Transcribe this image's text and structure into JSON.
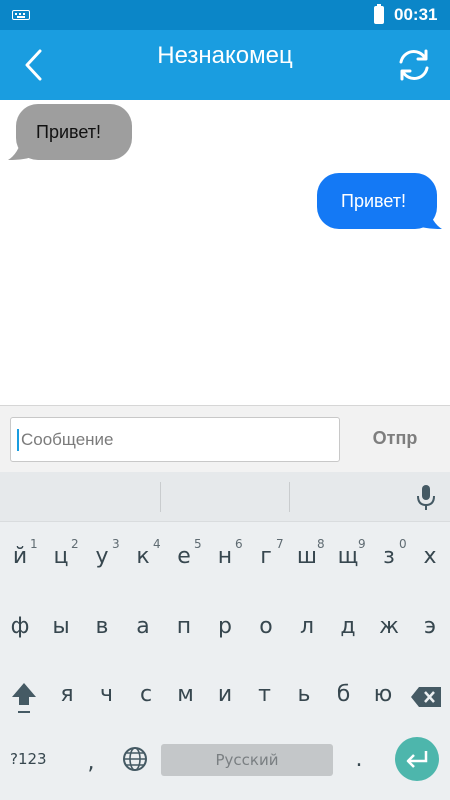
{
  "status_bar": {
    "time": "00:31"
  },
  "header": {
    "title": "Незнакомец"
  },
  "messages": [
    {
      "text": "Привет!",
      "from": "stranger"
    },
    {
      "text": "Привет!",
      "from": "me"
    }
  ],
  "composer": {
    "placeholder": "Сообщение",
    "send_label": "Отпр"
  },
  "keyboard": {
    "row1": [
      "й",
      "ц",
      "у",
      "к",
      "е",
      "н",
      "г",
      "ш",
      "щ",
      "з",
      "х"
    ],
    "row1_hints": [
      "1",
      "2",
      "3",
      "4",
      "5",
      "6",
      "7",
      "8",
      "9",
      "0"
    ],
    "row2": [
      "ф",
      "ы",
      "в",
      "а",
      "п",
      "р",
      "о",
      "л",
      "д",
      "ж",
      "э"
    ],
    "row3": [
      "я",
      "ч",
      "с",
      "м",
      "и",
      "т",
      "ь",
      "б",
      "ю"
    ],
    "symbols_label": "?123",
    "comma": ",",
    "period": ".",
    "space_label": "Русский"
  },
  "colors": {
    "status_bar": "#0b86c8",
    "action_bar": "#1a9de0",
    "incoming_bubble": "#9e9e9e",
    "outgoing_bubble": "#1479f5",
    "enter_key": "#4db6ac"
  }
}
